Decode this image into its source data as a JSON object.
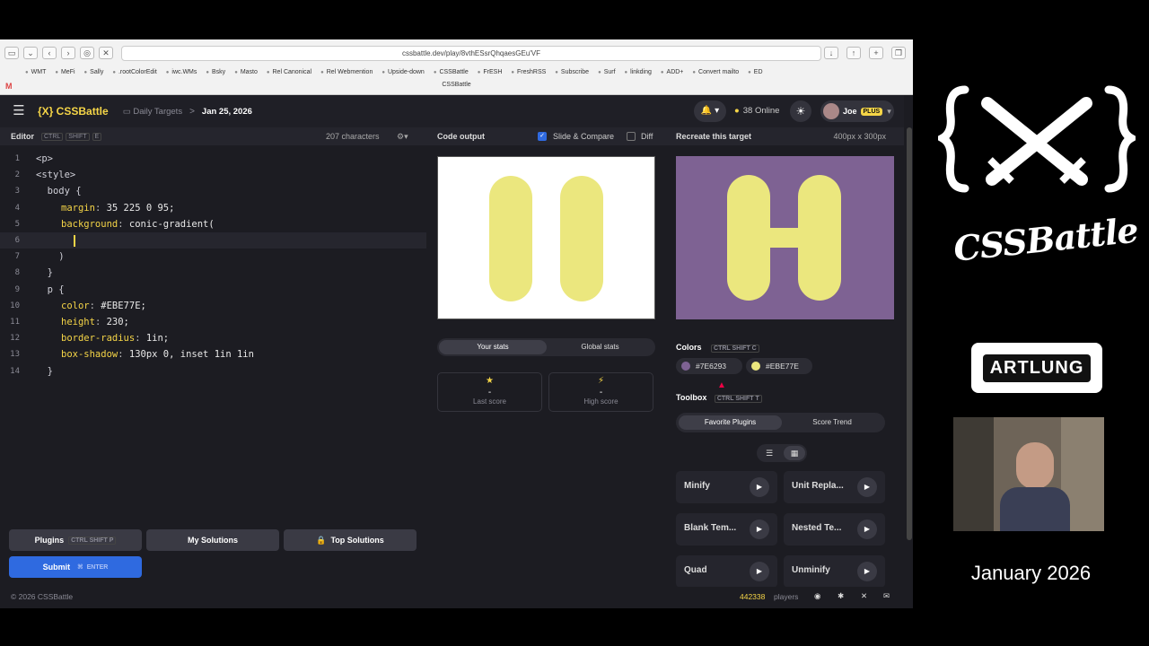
{
  "browser": {
    "url": "cssbattle.dev/play/8vthESsrQhqaesGEu'VF",
    "bookmarks": [
      "WMT",
      "MeFi",
      "Sally",
      ".rootColorEdit",
      "iwc.WMs",
      "Bsky",
      "Masto",
      "Rel Canonical",
      "Rel Webmention",
      "Upside-down",
      "CSSBattle",
      "FrESH",
      "FreshRSS",
      "Subscribe",
      "Surf",
      "linkding",
      "ADD+",
      "Convert mailto",
      "ED"
    ],
    "tab_title": "CSSBattle"
  },
  "header": {
    "logo": "{X} CSSBattle",
    "crumb_daily": "Daily Targets",
    "crumb_sep": ">",
    "crumb_date": "Jan 25, 2026",
    "online_count": "38 Online",
    "user_name": "Joe",
    "user_badge": "PLUS"
  },
  "editor": {
    "title": "Editor",
    "shortcut": [
      "CTRL",
      "SHIFT",
      "E"
    ],
    "char_count": "207 characters",
    "lines": [
      {
        "n": "1",
        "text": "<p>"
      },
      {
        "n": "2",
        "text": "<style>"
      },
      {
        "n": "3",
        "text": "  body {"
      },
      {
        "n": "4",
        "prop": "margin",
        "val": "35 225 0 95;"
      },
      {
        "n": "5",
        "prop": "background",
        "val": "conic-gradient("
      },
      {
        "n": "6",
        "text": ""
      },
      {
        "n": "7",
        "text": "    )"
      },
      {
        "n": "8",
        "text": "  }"
      },
      {
        "n": "9",
        "text": "  p {"
      },
      {
        "n": "10",
        "prop": "color",
        "val": "#EBE77E;"
      },
      {
        "n": "11",
        "prop": "height",
        "val": "230;"
      },
      {
        "n": "12",
        "prop": "border-radius",
        "val": "1in;"
      },
      {
        "n": "13",
        "prop": "box-shadow",
        "val": "130px 0, inset 1in 1in"
      },
      {
        "n": "14",
        "text": "  }"
      }
    ]
  },
  "buttons": {
    "plugins": "Plugins",
    "plugins_keys": "CTRL SHIFT P",
    "my_solutions": "My Solutions",
    "top_solutions": "Top Solutions",
    "submit": "Submit",
    "submit_keys": "ENTER"
  },
  "output": {
    "title": "Code output",
    "slide_compare": "Slide & Compare",
    "diff": "Diff",
    "tab_your": "Your stats",
    "tab_global": "Global stats",
    "last_score_label": "Last score",
    "high_score_label": "High score",
    "last_score": "-",
    "high_score": "-"
  },
  "target": {
    "title": "Recreate this target",
    "size": "400px x 300px",
    "bg": "#7E6293",
    "fg": "#EBE77E"
  },
  "colors": {
    "title": "Colors",
    "keys": "CTRL SHIFT C",
    "c1": "#7E6293",
    "c2": "#EBE77E"
  },
  "toolbox": {
    "title": "Toolbox",
    "keys": "CTRL SHIFT T",
    "tab_fav": "Favorite Plugins",
    "tab_trend": "Score Trend",
    "plugins": [
      "Minify",
      "Unit Repla...",
      "Blank Tem...",
      "Nested Te...",
      "Quad",
      "Unminify"
    ]
  },
  "footer": {
    "copyright": "© 2026 CSSBattle",
    "players_count": "442338",
    "players_label": "players"
  },
  "overlay": {
    "brand_line": "CSSBattle",
    "artlung": "ARTLUNG",
    "date": "January 2026"
  }
}
